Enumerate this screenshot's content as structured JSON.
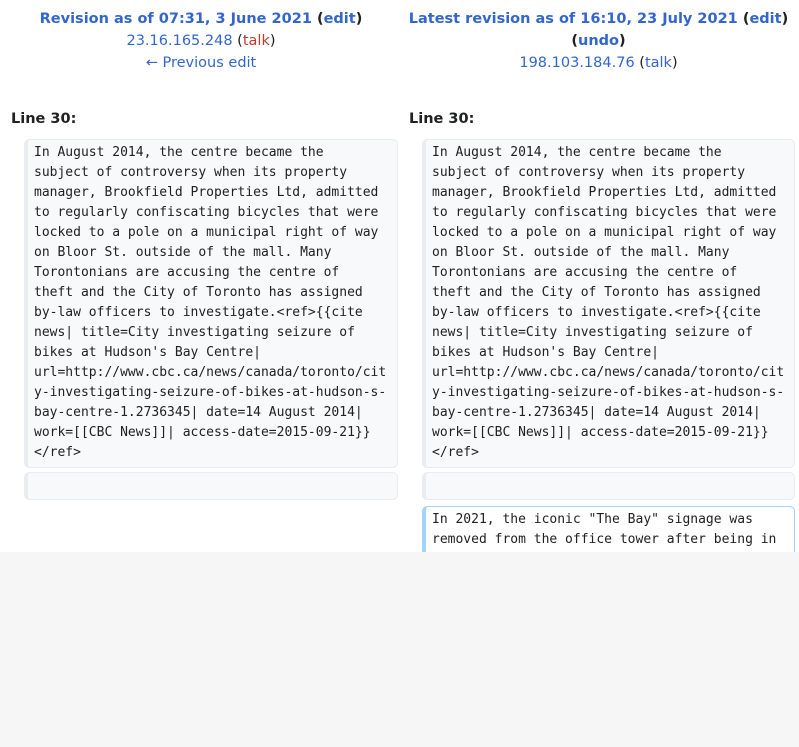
{
  "left": {
    "title_prefix": "Revision as of 07:31, 3 June 2021",
    "edit_label": "edit",
    "user": "23.16.165.248",
    "talk_label": "talk",
    "prev_label": "← Previous edit",
    "line_label": "Line 30:",
    "context_text": "In August 2014, the centre became the\nsubject of controversy when its property\nmanager, Brookfield Properties Ltd, admitted\nto regularly confiscating bicycles that were\nlocked to a pole on a municipal right of way\non Bloor St. outside of the mall. Many\nTorontonians are accusing the centre of\ntheft and the City of Toronto has assigned\nby-law officers to investigate.<ref>{{cite\nnews| title=City investigating seizure of\nbikes at Hudson's Bay Centre|\nurl=http://www.cbc.ca/news/canada/toronto/cit\ny-investigating-seizure-of-bikes-at-hudson-s-\nbay-centre-1.2736345| date=14 August 2014|\nwork=[[CBC News]]| access-date=2015-09-21}}\n</ref>"
  },
  "right": {
    "title_prefix": "Latest revision as of 16:10, 23 July 2021",
    "edit_label": "edit",
    "undo_label": "undo",
    "user": "198.103.184.76",
    "talk_label": "talk",
    "line_label": "Line 30:",
    "context_text": "In August 2014, the centre became the\nsubject of controversy when its property\nmanager, Brookfield Properties Ltd, admitted\nto regularly confiscating bicycles that were\nlocked to a pole on a municipal right of way\non Bloor St. outside of the mall. Many\nTorontonians are accusing the centre of\ntheft and the City of Toronto has assigned\nby-law officers to investigate.<ref>{{cite\nnews| title=City investigating seizure of\nbikes at Hudson's Bay Centre|\nurl=http://www.cbc.ca/news/canada/toronto/cit\ny-investigating-seizure-of-bikes-at-hudson-s-\nbay-centre-1.2736345| date=14 August 2014|\nwork=[[CBC News]]| access-date=2015-09-21}}\n</ref>",
    "added_text": "In 2021, the iconic \"The Bay\" signage was\nremoved from the office tower after being in"
  },
  "colors": {
    "link": "#3366cc",
    "talk_red": "#bf3c2c",
    "added_border": "#a3d3ff",
    "context_bg": "#f8f9fa"
  }
}
